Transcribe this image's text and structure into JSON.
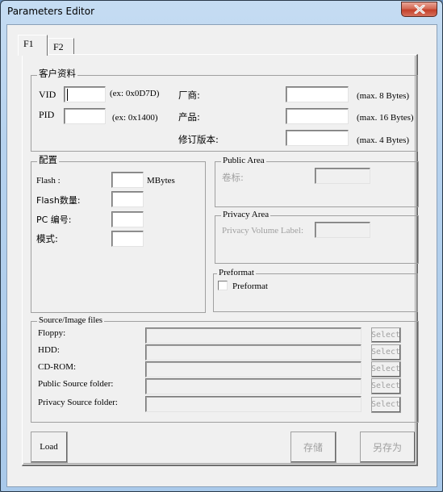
{
  "window": {
    "title": "Parameters Editor",
    "close_icon": "close-icon"
  },
  "tabs": [
    {
      "label": "F1",
      "active": true
    },
    {
      "label": "F2",
      "active": false
    }
  ],
  "customer": {
    "title": "客户资料",
    "vid": {
      "label": "VID",
      "value": "",
      "hint": "(ex: 0x0D7D)"
    },
    "pid": {
      "label": "PID",
      "value": "",
      "hint": "(ex: 0x1400)"
    },
    "vendor": {
      "label": "厂商:",
      "value": "",
      "hint": "(max. 8 Bytes)"
    },
    "product": {
      "label": "产品:",
      "value": "",
      "hint": "(max. 16 Bytes)"
    },
    "revision": {
      "label": "修订版本:",
      "value": "",
      "hint": "(max. 4 Bytes)"
    }
  },
  "config": {
    "title": "配置",
    "flash": {
      "label": "Flash :",
      "value": "",
      "unit": "MBytes"
    },
    "flash_count": {
      "label": "Flash数量:",
      "value": ""
    },
    "pc_number": {
      "label": "PC 编号:",
      "value": ""
    },
    "mode": {
      "label": "模式:",
      "value": ""
    }
  },
  "public_area": {
    "title": "Public Area",
    "volume_label": {
      "label": "卷标:",
      "value": ""
    }
  },
  "privacy_area": {
    "title": "Privacy Area",
    "volume_label": {
      "label": "Privacy Volume Label:",
      "value": ""
    }
  },
  "preformat": {
    "title": "Preformat",
    "checkbox_label": "Preformat",
    "checked": false
  },
  "source": {
    "title": "Source/Image files",
    "rows": [
      {
        "label": "Floppy:",
        "value": "",
        "button": "Select"
      },
      {
        "label": "HDD:",
        "value": "",
        "button": "Select"
      },
      {
        "label": "CD-ROM:",
        "value": "",
        "button": "Select"
      },
      {
        "label": "Public Source folder:",
        "value": "",
        "button": "Select"
      },
      {
        "label": "Privacy Source folder:",
        "value": "",
        "button": "Select"
      }
    ]
  },
  "footer": {
    "load": "Load",
    "save": "存储",
    "save_as": "另存为"
  }
}
